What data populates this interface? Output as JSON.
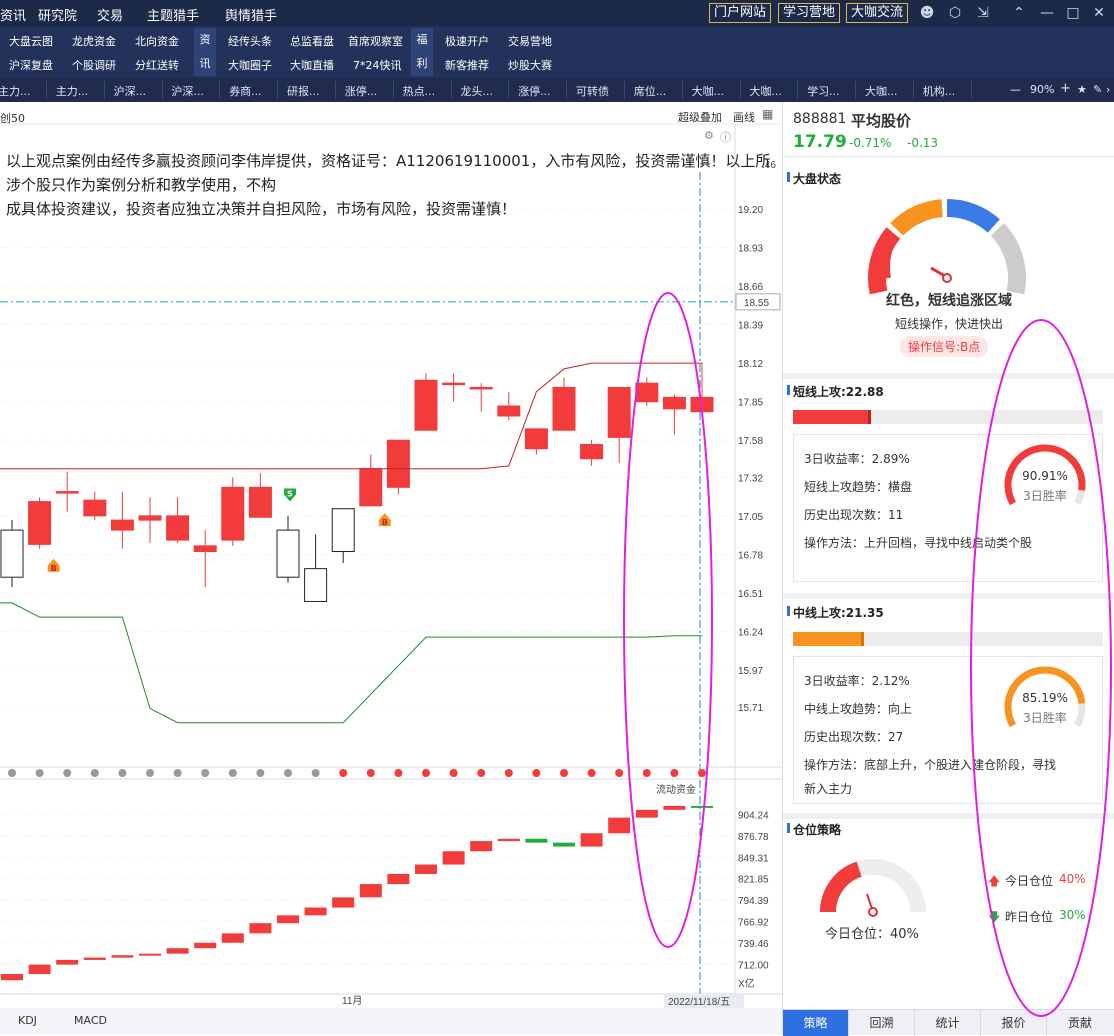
{
  "top_menu": [
    "资讯",
    "研究院",
    "交易",
    "主题猎手",
    "舆情猎手"
  ],
  "top_buttons": [
    "门户网站",
    "学习营地",
    "大咖交流"
  ],
  "nav2": {
    "col1": [
      "大盘云图",
      "沪深复盘"
    ],
    "col2": [
      "龙虎资金",
      "个股调研"
    ],
    "col3": [
      "北向资金",
      "分红送转"
    ],
    "v1": [
      "资",
      "讯"
    ],
    "col4": [
      "经传头条",
      "大咖圈子"
    ],
    "col5": [
      "总监看盘",
      "大咖直播"
    ],
    "col6": [
      "首席观察室",
      "7*24快讯"
    ],
    "v2": [
      "福",
      "利"
    ],
    "col7": [
      "极速开户",
      "新客推荐"
    ],
    "col8": [
      "交易营地",
      "炒股大赛"
    ]
  },
  "tabs3": [
    "主力...",
    "主力...",
    "沪深...",
    "沪深...",
    "券商...",
    "研报...",
    "涨停...",
    "热点...",
    "龙头...",
    "涨停...",
    "可转债",
    "席位...",
    "大咖...",
    "大咖...",
    "学习...",
    "大咖...",
    "机构..."
  ],
  "zoom": "90%",
  "chart": {
    "top_left_label": "创50",
    "tools": [
      "超级叠加",
      "画线"
    ],
    "disclaimer_line1": "以上观点案例由经传多赢投资顾问李伟岸提供，资格证号：A1120619110001，入市有风险，投资需谨慎！以上所涉个股只作为案例分析和教学使用，不构",
    "disclaimer_line2": "成具体投资建议，投资者应独立决策并自担风险，市场有风险，投资需谨慎！",
    "price_ticks": [
      "19.20",
      "18.93",
      "18.66",
      "18.39",
      "18.12",
      "17.85",
      "17.58",
      "17.32",
      "17.05",
      "16.78",
      "16.51",
      "16.24",
      "15.97",
      "15.71"
    ],
    "crosshair_price": "18.55",
    "partial_top_tick": ".46",
    "sub_label": "流动资金",
    "sub_ticks": [
      "904.24",
      "876.78",
      "849.31",
      "821.85",
      "794.39",
      "766.92",
      "739.46",
      "712.00"
    ],
    "sub_unit": "X亿",
    "month_label": "11月",
    "date_label": "2022/11/18/五",
    "indicator_tabs": [
      "KDJ",
      "MACD"
    ],
    "signal_b": "B",
    "signal_s": "S"
  },
  "chart_data": {
    "type": "candlestick",
    "ylim": [
      15.5,
      19.46
    ],
    "candles": [
      {
        "o": 16.62,
        "c": 16.95,
        "h": 17.02,
        "l": 16.55,
        "up": false
      },
      {
        "o": 16.85,
        "c": 17.15,
        "h": 17.18,
        "l": 16.82,
        "up": true
      },
      {
        "o": 17.22,
        "c": 17.22,
        "h": 17.36,
        "l": 17.08,
        "up": true
      },
      {
        "o": 17.16,
        "c": 17.05,
        "h": 17.22,
        "l": 17.02,
        "up": true
      },
      {
        "o": 17.02,
        "c": 16.95,
        "h": 17.22,
        "l": 16.82,
        "up": true
      },
      {
        "o": 17.02,
        "c": 17.05,
        "h": 17.18,
        "l": 16.86,
        "up": true
      },
      {
        "o": 17.05,
        "c": 16.88,
        "h": 17.18,
        "l": 16.86,
        "up": true
      },
      {
        "o": 16.84,
        "c": 16.8,
        "h": 16.95,
        "l": 16.55,
        "up": true
      },
      {
        "o": 16.88,
        "c": 17.25,
        "h": 17.32,
        "l": 16.84,
        "up": true
      },
      {
        "o": 17.25,
        "c": 17.04,
        "h": 17.35,
        "l": 17.04,
        "up": true
      },
      {
        "o": 16.95,
        "c": 16.62,
        "h": 17.05,
        "l": 16.58,
        "up": false
      },
      {
        "o": 16.68,
        "c": 16.45,
        "h": 16.92,
        "l": 16.45,
        "up": false
      },
      {
        "o": 16.8,
        "c": 17.1,
        "h": 17.1,
        "l": 16.72,
        "up": false
      },
      {
        "o": 17.12,
        "c": 17.38,
        "h": 17.48,
        "l": 17.12,
        "up": true
      },
      {
        "o": 17.25,
        "c": 17.58,
        "h": 17.58,
        "l": 17.2,
        "up": true
      },
      {
        "o": 17.65,
        "c": 18.0,
        "h": 18.05,
        "l": 17.65,
        "up": true
      },
      {
        "o": 17.98,
        "c": 17.98,
        "h": 18.05,
        "l": 17.85,
        "up": true
      },
      {
        "o": 17.95,
        "c": 17.95,
        "h": 17.98,
        "l": 17.78,
        "up": true
      },
      {
        "o": 17.82,
        "c": 17.75,
        "h": 17.92,
        "l": 17.72,
        "up": true
      },
      {
        "o": 17.66,
        "c": 17.52,
        "h": 17.66,
        "l": 17.48,
        "up": true
      },
      {
        "o": 17.65,
        "c": 17.95,
        "h": 18.02,
        "l": 17.65,
        "up": true
      },
      {
        "o": 17.55,
        "c": 17.45,
        "h": 17.58,
        "l": 17.4,
        "up": true
      },
      {
        "o": 17.6,
        "c": 17.95,
        "h": 17.95,
        "l": 17.42,
        "up": true
      },
      {
        "o": 17.85,
        "c": 17.98,
        "h": 18.02,
        "l": 17.82,
        "up": true
      },
      {
        "o": 17.8,
        "c": 17.88,
        "h": 17.9,
        "l": 17.62,
        "up": true
      },
      {
        "o": 17.78,
        "c": 17.88,
        "h": 18.12,
        "l": 17.78,
        "up": true
      }
    ],
    "upper_band": [
      17.38,
      17.38,
      17.38,
      17.38,
      17.38,
      17.38,
      17.38,
      17.38,
      17.38,
      17.38,
      17.38,
      17.38,
      17.38,
      17.38,
      17.38,
      17.38,
      17.38,
      17.38,
      17.4,
      17.92,
      18.08,
      18.12,
      18.12,
      18.12,
      18.12,
      18.12
    ],
    "lower_band": [
      16.44,
      16.34,
      16.34,
      16.34,
      16.34,
      15.7,
      15.6,
      15.6,
      15.6,
      15.6,
      15.6,
      15.6,
      15.6,
      15.8,
      16.0,
      16.2,
      16.2,
      16.2,
      16.2,
      16.2,
      16.2,
      16.2,
      16.2,
      16.2,
      16.21,
      16.21
    ],
    "sub_ylim": [
      700,
      920
    ],
    "sub_values": [
      700,
      712,
      718,
      721,
      724,
      726,
      733,
      740,
      752,
      765,
      775,
      785,
      798,
      815,
      828,
      840,
      857,
      870,
      873,
      868,
      863,
      880,
      900,
      910,
      915,
      914
    ]
  },
  "panel": {
    "code": "888881",
    "name": "平均股价",
    "price": "17.79",
    "pct": "-0.71%",
    "chg": "-0.13",
    "market": {
      "title": "大盘状态",
      "status": "红色，短线追涨区域",
      "advice": "短线操作，快进快出",
      "signal": "操作信号:B点"
    },
    "short": {
      "title": "短线上攻:22.88",
      "progress": 0.25,
      "ret": "3日收益率：2.89%",
      "trend": "短线上攻趋势：横盘",
      "count": "历史出现次数：11",
      "method": "操作方法：上升回档，寻找中线启动类个股",
      "win": "90.91%",
      "win_label": "3日胜率",
      "win_value": 0.9091
    },
    "mid": {
      "title": "中线上攻:21.35",
      "progress": 0.23,
      "ret": "3日收益率：2.12%",
      "trend": "中线上攻趋势：向上",
      "count": "历史出现次数：27",
      "method1": "操作方法：底部上升，个股进入建仓阶段，寻找",
      "method2": "新入主力",
      "win": "85.19%",
      "win_label": "3日胜率",
      "win_value": 0.8519
    },
    "position": {
      "title": "仓位策略",
      "today_label": "今日仓位：40%",
      "today_small": "今日仓位",
      "today_val": "40%",
      "yesterday_small": "昨日仓位",
      "yesterday_val": "30%",
      "level": 0.4
    },
    "tabs": [
      "策略",
      "回溯",
      "统计",
      "报价",
      "贡献"
    ]
  },
  "colors": {
    "up": "#f23b3b",
    "down": "#1fae3c",
    "accent": "#2f6fe0",
    "ellipse": "#e020e0",
    "orange": "#f7931e"
  }
}
